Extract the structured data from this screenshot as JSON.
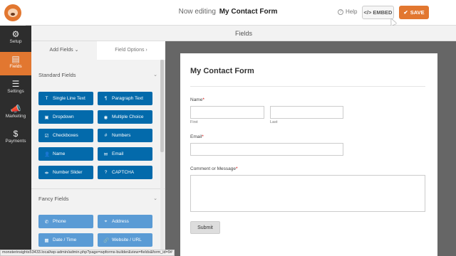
{
  "header": {
    "editing_prefix": "Now editing",
    "form_name": "My Contact Form",
    "help_label": "Help",
    "embed_label": "EMBED",
    "embed_icon": "</>",
    "save_label": "SAVE",
    "save_icon": "✔"
  },
  "nav": {
    "items": [
      {
        "label": "Setup",
        "icon": "⚙"
      },
      {
        "label": "Fields",
        "icon": "▤"
      },
      {
        "label": "Settings",
        "icon": "☰"
      },
      {
        "label": "Marketing",
        "icon": "📣"
      },
      {
        "label": "Payments",
        "icon": "$"
      }
    ]
  },
  "fields_bar": {
    "title": "Fields"
  },
  "panel": {
    "tab_add": "Add Fields",
    "tab_add_chevron": "⌄",
    "tab_options": "Field Options",
    "tab_options_chevron": "›",
    "standard_title": "Standard Fields",
    "fancy_title": "Fancy Fields",
    "section_chevron": "⌄",
    "standard_fields": [
      {
        "label": "Single Line Text",
        "icon": "T"
      },
      {
        "label": "Paragraph Text",
        "icon": "¶"
      },
      {
        "label": "Dropdown",
        "icon": "▣"
      },
      {
        "label": "Multiple Choice",
        "icon": "◉"
      },
      {
        "label": "Checkboxes",
        "icon": "☑"
      },
      {
        "label": "Numbers",
        "icon": "#"
      },
      {
        "label": "Name",
        "icon": "👤"
      },
      {
        "label": "Email",
        "icon": "✉"
      },
      {
        "label": "Number Slider",
        "icon": "⇹"
      },
      {
        "label": "CAPTCHA",
        "icon": "?"
      }
    ],
    "fancy_fields": [
      {
        "label": "Phone",
        "icon": "✆"
      },
      {
        "label": "Address",
        "icon": "⌖"
      },
      {
        "label": "Date / Time",
        "icon": "▦"
      },
      {
        "label": "Website / URL",
        "icon": "🔗"
      }
    ]
  },
  "form": {
    "title": "My Contact Form",
    "name_label": "Name",
    "required_mark": "*",
    "first_label": "First",
    "last_label": "Last",
    "email_label": "Email",
    "message_label": "Comment or Message",
    "submit_label": "Submit"
  },
  "status_bar": {
    "url": "monsterinsights53433.local/wp-admin/admin.php?page=wpforms-builder&view=fields&form_id=9#"
  },
  "colors": {
    "accent": "#e27730",
    "field_button": "#036aab",
    "fancy_button": "#5a9bd5",
    "nav_bg": "#2d2d2d",
    "preview_bg": "#666666"
  }
}
